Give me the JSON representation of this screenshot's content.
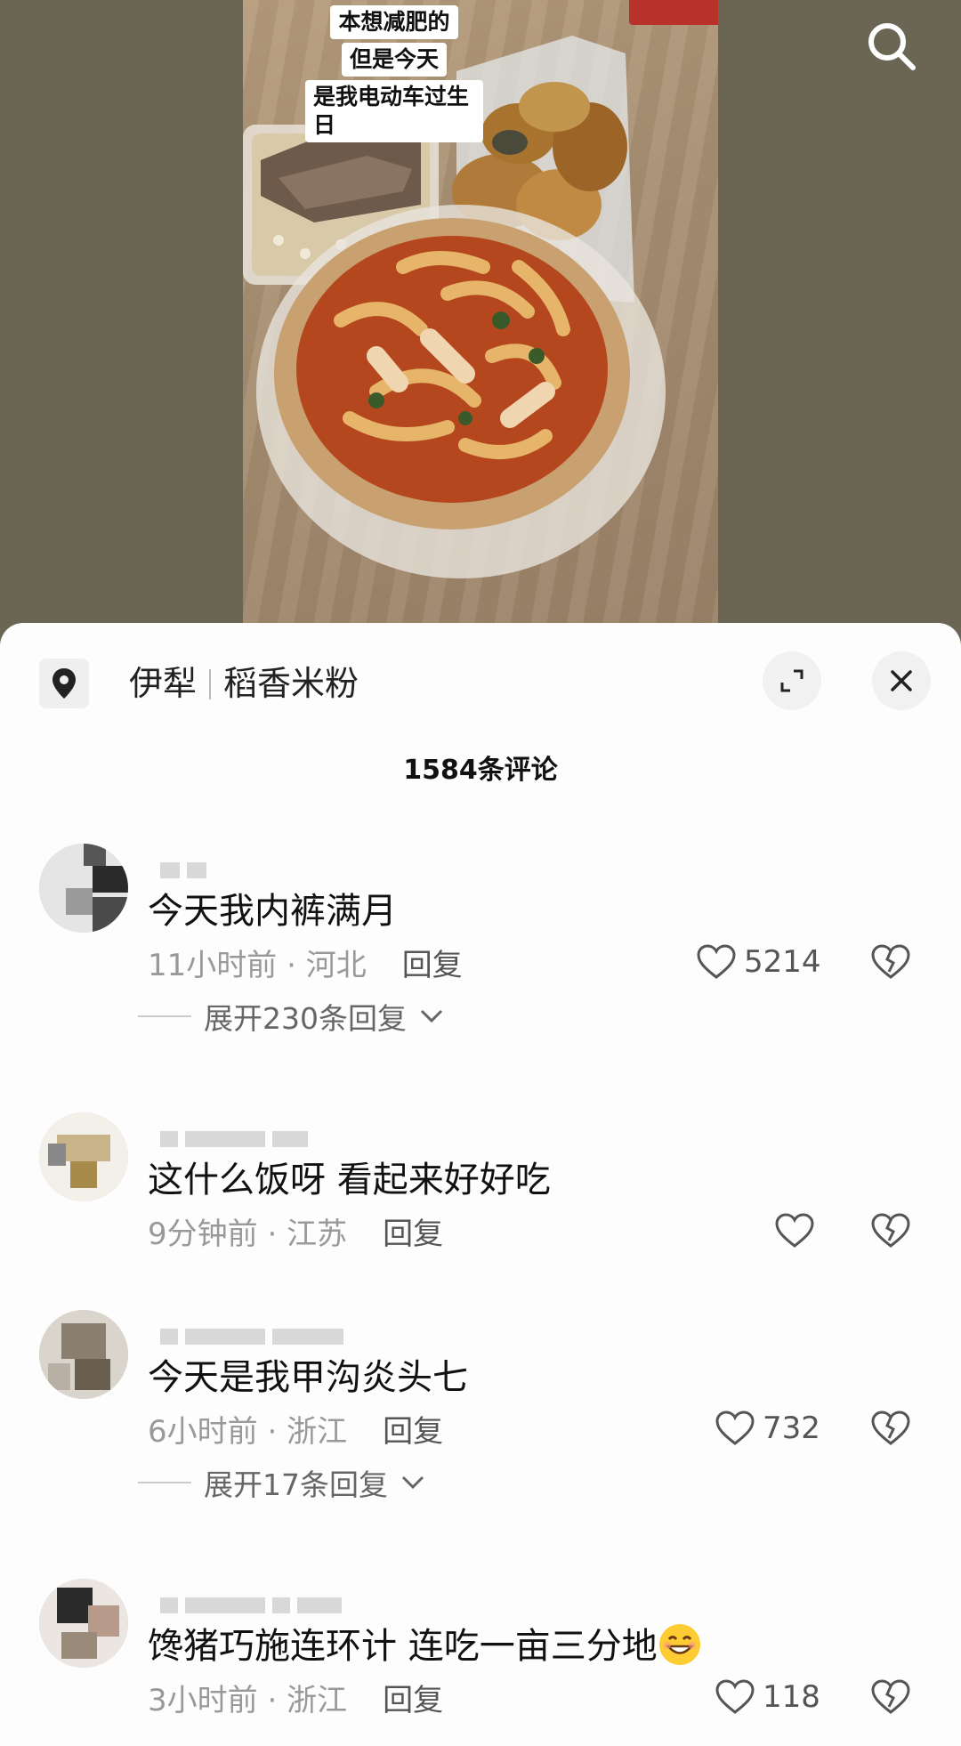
{
  "video": {
    "caption_lines": [
      "本想减肥的",
      "但是今天",
      "是我电动车过生日"
    ],
    "search_icon": "search-icon"
  },
  "sheet": {
    "location": {
      "icon": "location-pin-icon",
      "city": "伊犁",
      "place": "稻香米粉"
    },
    "expand_icon": "expand-icon",
    "close_icon": "close-icon",
    "comment_count": "1584条评论"
  },
  "comments": [
    {
      "text": "今天我内裤满月",
      "time": "11小时前",
      "region": "河北",
      "reply_label": "回复",
      "likes": "5214",
      "expand": "展开230条回复"
    },
    {
      "text": "这什么饭呀 看起来好好吃",
      "time": "9分钟前",
      "region": "江苏",
      "reply_label": "回复",
      "likes": ""
    },
    {
      "text": "今天是我甲沟炎头七",
      "time": "6小时前",
      "region": "浙江",
      "reply_label": "回复",
      "likes": "732",
      "expand": "展开17条回复"
    },
    {
      "text": "馋猪巧施连环计 连吃一亩三分地",
      "time": "3小时前",
      "region": "浙江",
      "reply_label": "回复",
      "likes": "118"
    }
  ],
  "meta_separator": " · ",
  "icons": {
    "like": "heart-icon",
    "dislike": "broken-heart-icon",
    "chevron": "chevron-down-icon",
    "emoji": "grin-emoji-icon"
  }
}
